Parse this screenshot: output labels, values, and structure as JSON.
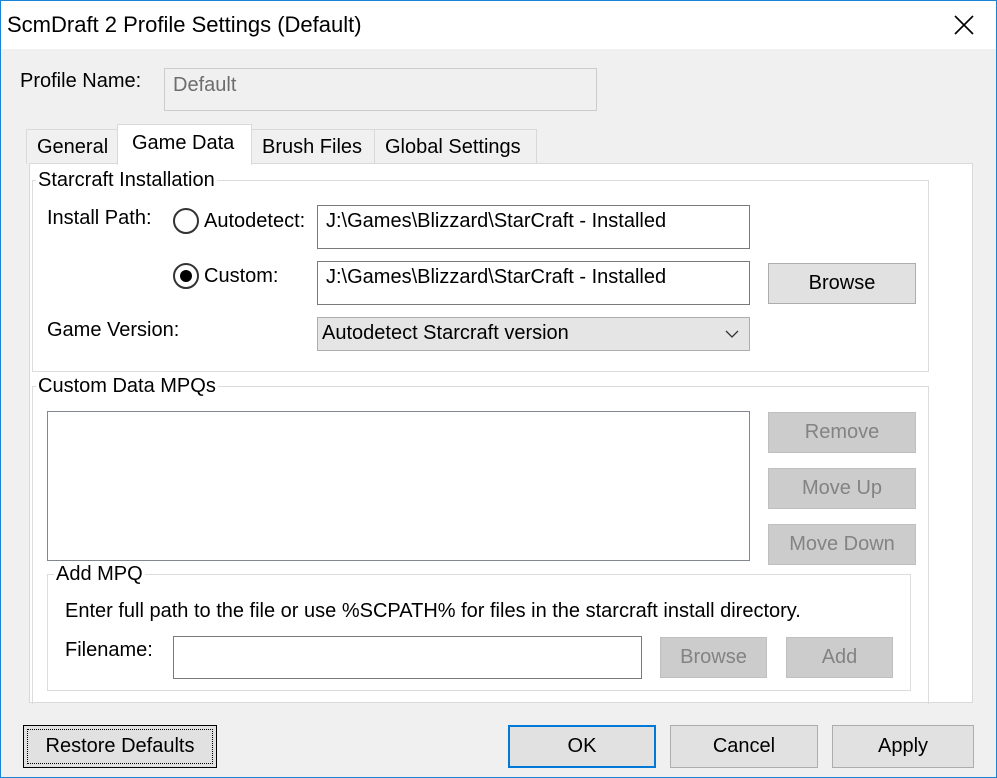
{
  "window": {
    "title": "ScmDraft 2 Profile Settings (Default)",
    "close_icon": "close-icon"
  },
  "profile": {
    "label": "Profile Name:",
    "value": "Default"
  },
  "tabs": [
    {
      "label": "General",
      "active": false
    },
    {
      "label": "Game Data",
      "active": true
    },
    {
      "label": "Brush Files",
      "active": false
    },
    {
      "label": "Global Settings",
      "active": false
    }
  ],
  "starcraft_installation": {
    "group_label": "Starcraft Installation",
    "install_path_label": "Install Path:",
    "autodetect": {
      "label": "Autodetect:",
      "selected": false,
      "value": "J:\\Games\\Blizzard\\StarCraft - Installed"
    },
    "custom": {
      "label": "Custom:",
      "selected": true,
      "value": "J:\\Games\\Blizzard\\StarCraft - Installed"
    },
    "browse_label": "Browse",
    "game_version_label": "Game Version:",
    "game_version_value": "Autodetect Starcraft version"
  },
  "custom_mpqs": {
    "group_label": "Custom Data MPQs",
    "items": [],
    "remove_label": "Remove",
    "move_up_label": "Move Up",
    "move_down_label": "Move Down"
  },
  "add_mpq": {
    "group_label": "Add MPQ",
    "hint": "Enter full path to the file or use %SCPATH% for files in the starcraft install directory.",
    "filename_label": "Filename:",
    "filename_value": "",
    "browse_label": "Browse",
    "add_label": "Add"
  },
  "footer": {
    "restore_label": "Restore Defaults",
    "ok_label": "OK",
    "cancel_label": "Cancel",
    "apply_label": "Apply"
  },
  "colors": {
    "accent": "#0078d7",
    "window_border": "#1883d7",
    "dialog_bg": "#f0f0f0",
    "disabled_text": "#838383"
  }
}
